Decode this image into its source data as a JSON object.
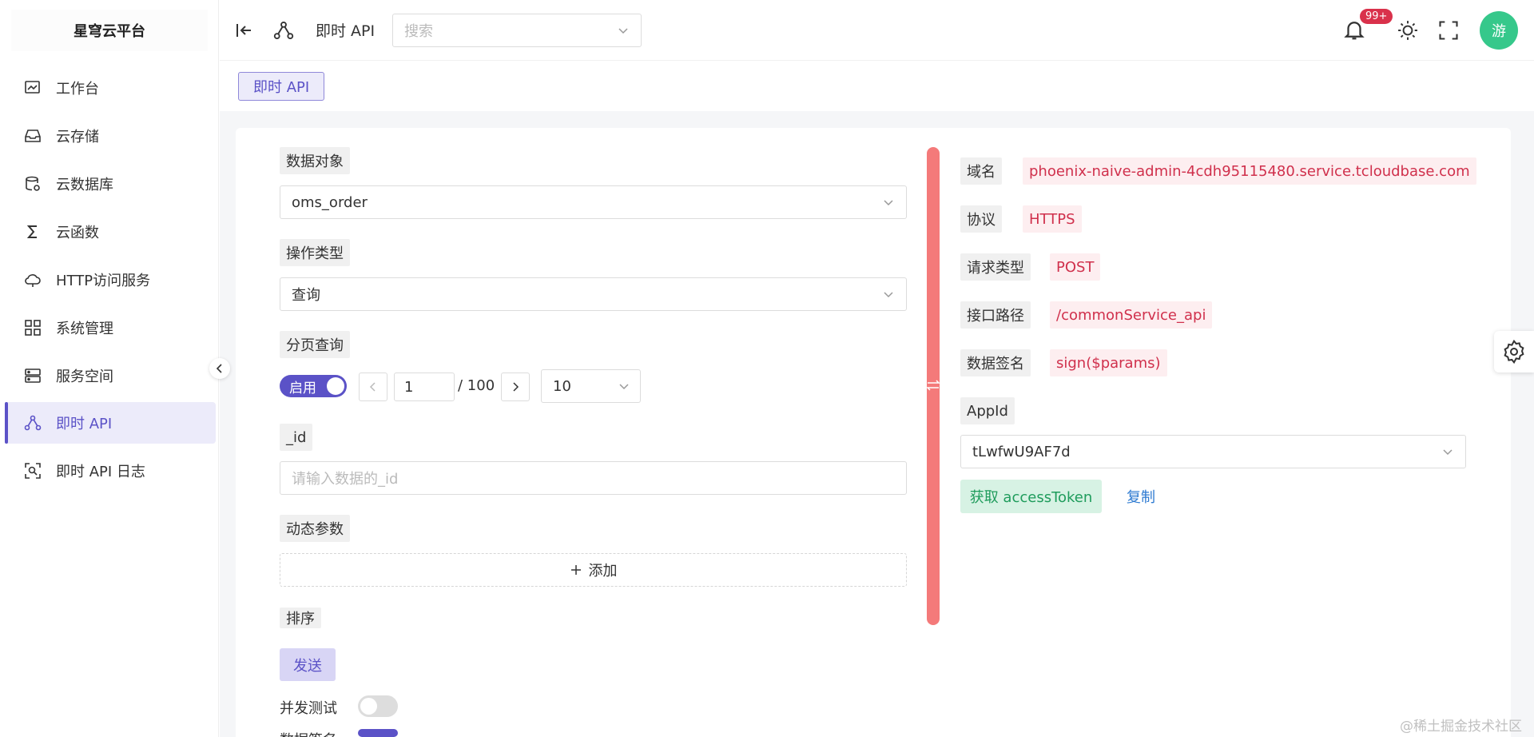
{
  "sidebar": {
    "brand": "星穹云平台",
    "items": [
      {
        "label": "工作台",
        "icon": "dashboard-icon"
      },
      {
        "label": "云存储",
        "icon": "inbox-icon"
      },
      {
        "label": "云数据库",
        "icon": "database-icon"
      },
      {
        "label": "云函数",
        "icon": "sigma-icon"
      },
      {
        "label": "HTTP访问服务",
        "icon": "cloud-icon"
      },
      {
        "label": "系统管理",
        "icon": "grid-icon"
      },
      {
        "label": "服务空间",
        "icon": "server-icon"
      },
      {
        "label": "即时 API",
        "icon": "share-nodes-icon",
        "active": true
      },
      {
        "label": "即时 API 日志",
        "icon": "scan-log-icon"
      }
    ]
  },
  "header": {
    "title": "即时 API",
    "search_placeholder": "搜索",
    "notification_badge": "99+",
    "avatar_text": "游"
  },
  "tabs": [
    {
      "label": "即时 API"
    }
  ],
  "form": {
    "data_object_label": "数据对象",
    "data_object_value": "oms_order",
    "operation_label": "操作类型",
    "operation_value": "查询",
    "paging_label": "分页查询",
    "paging_toggle": "启用",
    "page_current": "1",
    "page_total": "/ 100",
    "page_size": "10",
    "id_label": "_id",
    "id_placeholder": "请输入数据的_id",
    "dynamic_label": "动态参数",
    "add_label": "添加",
    "sort_label": "排序",
    "send_label": "发送",
    "concurrency_label": "并发测试",
    "signature_label": "数据签名"
  },
  "info": {
    "domain_label": "域名",
    "domain_value": "phoenix-naive-admin-4cdh95115480.service.tcloudbase.com",
    "protocol_label": "协议",
    "protocol_value": "HTTPS",
    "method_label": "请求类型",
    "method_value": "POST",
    "path_label": "接口路径",
    "path_value": "/commonService_api",
    "sign_label": "数据签名",
    "sign_value": "sign($params)",
    "appid_label": "AppId",
    "appid_value": "tLwfwU9AF7d",
    "token_button": "获取 accessToken",
    "copy_link": "复制"
  },
  "watermark": "@稀土掘金技术社区",
  "colors": {
    "accent": "#5b52c7",
    "danger": "#d0304c",
    "success": "#1f9c5c",
    "divider": "#f47a7a"
  }
}
